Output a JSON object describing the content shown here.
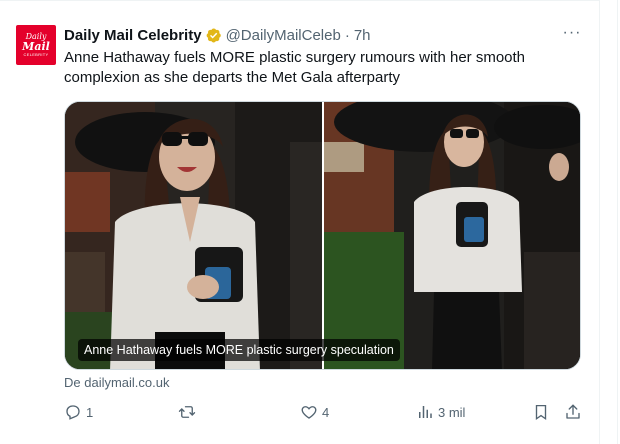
{
  "account": {
    "avatar_text": [
      "Daily",
      "Mail",
      "CELEBRITY"
    ],
    "name": "Daily Mail Celebrity",
    "handle": "@DailyMailCeleb",
    "separator": "·",
    "time": "7h",
    "verified_badge_color": "#e2b719"
  },
  "tweet": {
    "text": "Anne Hathaway fuels MORE plastic surgery rumours with her smooth complexion as she departs the Met Gala afterparty",
    "media_caption": "Anne Hathaway fuels MORE plastic surgery speculation",
    "source": "De dailymail.co.uk"
  },
  "actions": {
    "reply_count": "1",
    "retweet_count": "",
    "like_count": "4",
    "views_count": "3 mil"
  },
  "icons": {
    "reply": "reply-icon",
    "retweet": "retweet-icon",
    "like": "heart-icon",
    "views": "views-icon",
    "bookmark": "bookmark-icon",
    "share": "share-icon",
    "more": "more-icon"
  },
  "colors": {
    "brand_red": "#e4002b",
    "text_primary": "#0f1419",
    "text_secondary": "#536471"
  }
}
